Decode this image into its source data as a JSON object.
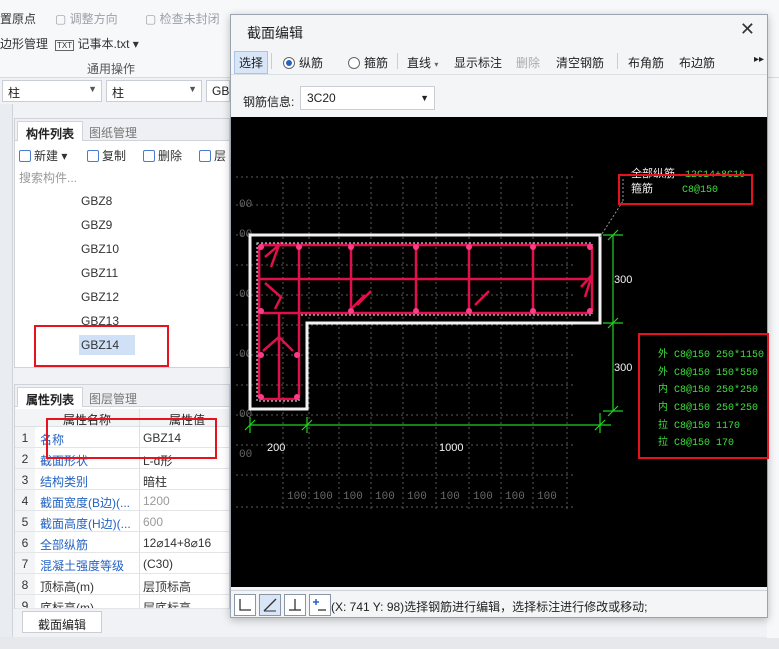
{
  "bg": {
    "toolbar": {
      "origin": "置原点",
      "adjust_dir": "调整方向",
      "check_closed": "检查未封闭",
      "polygon_mgmt": "边形管理",
      "notepad": "记事本.txt",
      "group_label": "通用操作"
    },
    "filter": {
      "type1": "柱",
      "type2": "柱",
      "type3": "GB"
    },
    "components": {
      "tabs": [
        "构件列表",
        "图纸管理"
      ],
      "tools": {
        "new": "新建",
        "copy": "复制",
        "delete": "删除",
        "layer": "层"
      },
      "search_placeholder": "搜索构件...",
      "items": [
        "GBZ8",
        "GBZ9",
        "GBZ10",
        "GBZ11",
        "GBZ12",
        "GBZ13",
        "GBZ14"
      ],
      "selected": "GBZ14"
    },
    "properties": {
      "tabs": [
        "属性列表",
        "图层管理"
      ],
      "headers": {
        "name": "属性名称",
        "value": "属性值"
      },
      "rows": [
        {
          "idx": "1",
          "name": "名称",
          "value": "GBZ14"
        },
        {
          "idx": "2",
          "name": "截面形状",
          "value": "L-d形"
        },
        {
          "idx": "3",
          "name": "结构类别",
          "value": "暗柱"
        },
        {
          "idx": "4",
          "name": "截面宽度(B边)(...",
          "value": "1200"
        },
        {
          "idx": "5",
          "name": "截面高度(H边)(...",
          "value": "600"
        },
        {
          "idx": "6",
          "name": "全部纵筋",
          "value": "12⌀14+8⌀16"
        },
        {
          "idx": "7",
          "name": "混凝土强度等级",
          "value": "(C30)"
        },
        {
          "idx": "8",
          "name": "顶标高(m)",
          "value": "层顶标高"
        },
        {
          "idx": "9",
          "name": "底标高(m)",
          "value": "层底标高"
        }
      ]
    },
    "section_edit_button": "截面编辑"
  },
  "dialog": {
    "title": "截面编辑",
    "toolbar": {
      "select": "选择",
      "longitudinal": "纵筋",
      "stirrup": "箍筋",
      "line": "直线",
      "show_annotation": "显示标注",
      "delete": "删除",
      "clear_rebar": "清空钢筋",
      "corner_bar": "布角筋",
      "edge_bar": "布边筋"
    },
    "rebar_info_label": "钢筋信息:",
    "rebar_info_value": "3C20",
    "canvas": {
      "leader_top": "全部纵筋",
      "leader_top_value": "12C14+8C16",
      "stirrup_label": "箍筋",
      "stirrup_value": "C8@150",
      "dim_300_a": "300",
      "dim_300_b": "300",
      "dim_200": "200",
      "dim_1000": "1000",
      "grid_100": "100",
      "grid_00": "00",
      "stirrup_specs": [
        "外 C8@150 250*1150",
        "外 C8@150 150*550",
        "内 C8@150 250*250",
        "内 C8@150 250*250",
        "拉 C8@150 1170",
        "拉 C8@150 170"
      ]
    },
    "status_text": "(X: 741 Y: 98)选择钢筋进行编辑，选择标注进行修改或移动;"
  },
  "colors": {
    "highlight": "#e8121e",
    "canvas_bg": "#000000",
    "rebar": "#e0104a",
    "dim_green": "#1fd41f",
    "text_green": "#3ee03e"
  }
}
